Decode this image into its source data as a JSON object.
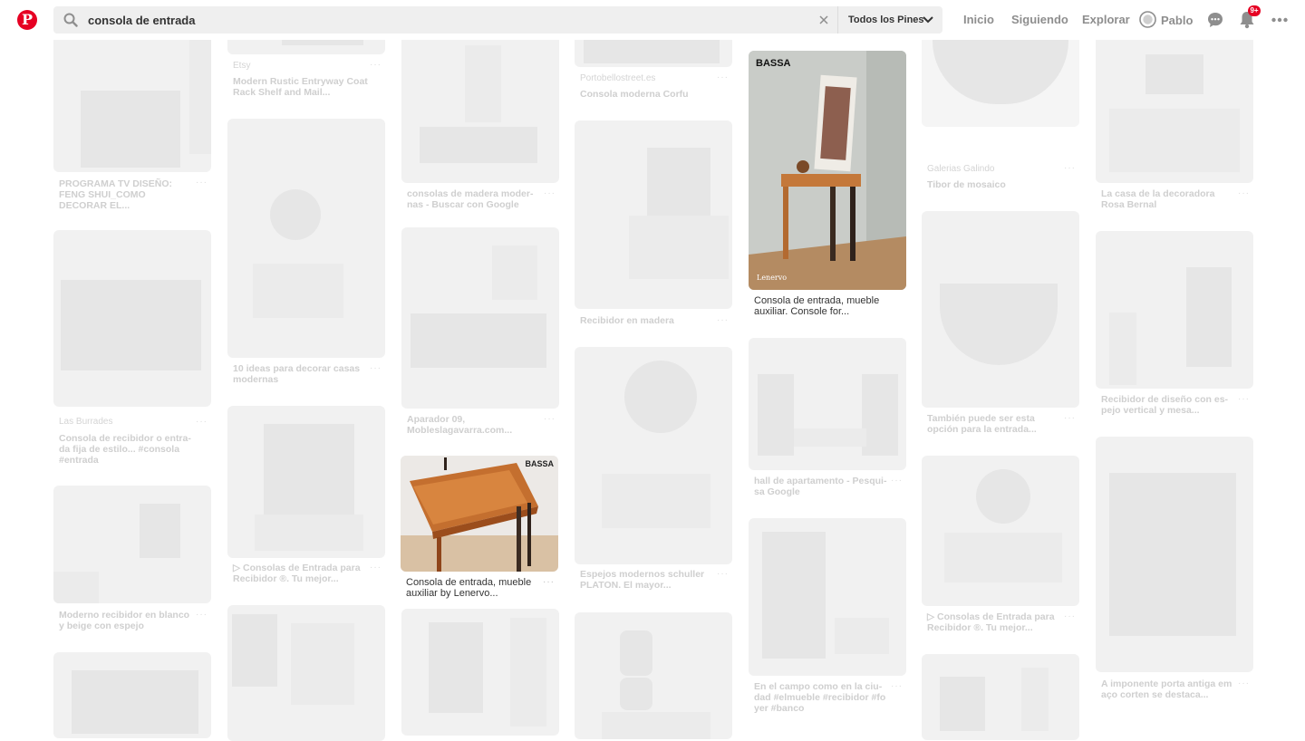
{
  "header": {
    "logo": "P",
    "search": {
      "value": "consola de entrada",
      "placeholder": "Buscar"
    },
    "scope": "Todos los Pines",
    "nav": {
      "home": "Inicio",
      "following": "Siguiendo",
      "explore": "Explorar",
      "profile": "Pablo"
    },
    "notifications_badge": "9+"
  },
  "pins": [
    {
      "id": "c1a",
      "caption": "PROGRAMA TV DISEÑO: FENG SHUI_COMO DECORAR EL...",
      "source": ""
    },
    {
      "id": "c1b",
      "caption": "Consola de recibidor o entra-da fija de estilo... #consola #entrada",
      "source": "Las Burrades"
    },
    {
      "id": "c1c",
      "caption": "Moderno recibidor en blanco y beige con espejo",
      "source": ""
    },
    {
      "id": "c1d",
      "caption": "",
      "source": ""
    },
    {
      "id": "c2a",
      "caption": "Modern Rustic Entryway Coat Rack Shelf and Mail...",
      "source": "Etsy"
    },
    {
      "id": "c2b",
      "caption": "10 ideas para decorar casas modernas",
      "source": ""
    },
    {
      "id": "c2c",
      "caption": "▷ Consolas de Entrada para Recibidor ®. Tu mejor...",
      "source": ""
    },
    {
      "id": "c2d",
      "caption": "",
      "source": ""
    },
    {
      "id": "c3a",
      "caption": "consolas de madera moder-nas - Buscar con Google",
      "source": ""
    },
    {
      "id": "c3b",
      "caption": "Aparador 09, Mobleslagavarra.com...",
      "source": ""
    },
    {
      "id": "c3c",
      "caption": "Consola de entrada, mueble auxiliar by Lenervo...",
      "source": "",
      "brand": "BASSA"
    },
    {
      "id": "c3d",
      "caption": "",
      "source": ""
    },
    {
      "id": "c4a",
      "caption": "Consola moderna Corfu",
      "source": "Portobellostreet.es"
    },
    {
      "id": "c4b",
      "caption": "Recibidor en madera",
      "source": ""
    },
    {
      "id": "c4c",
      "caption": "Espejos modernos schuller PLATON. El mayor...",
      "source": ""
    },
    {
      "id": "c4d",
      "caption": "",
      "source": ""
    },
    {
      "id": "c5a",
      "caption": "Consola de entrada, mueble auxiliar. Console for...",
      "source": "",
      "brand": "BASSA",
      "watermark": "Lenervo"
    },
    {
      "id": "c5b",
      "caption": "hall de apartamento - Pesqui-sa Google",
      "source": ""
    },
    {
      "id": "c5c",
      "caption": "En el campo como en la ciu-dad #elmueble #recibidor #fo yer #banco",
      "source": ""
    },
    {
      "id": "c6a",
      "caption": "Tibor de mosaico",
      "source": "Galerias Galindo"
    },
    {
      "id": "c6b",
      "caption": "También puede ser esta opción para la entrada...",
      "source": ""
    },
    {
      "id": "c6c",
      "caption": "▷ Consolas de Entrada para Recibidor ®. Tu mejor...",
      "source": ""
    },
    {
      "id": "c6d",
      "caption": "",
      "source": ""
    },
    {
      "id": "c7a",
      "caption": "La casa de la decoradora Rosa Bernal",
      "source": ""
    },
    {
      "id": "c7b",
      "caption": "Recibidor de diseño con es-pejo vertical y mesa...",
      "source": ""
    },
    {
      "id": "c7c",
      "caption": "A imponente porta antiga em aço corten se destaca...",
      "source": ""
    }
  ],
  "more_label": "···"
}
